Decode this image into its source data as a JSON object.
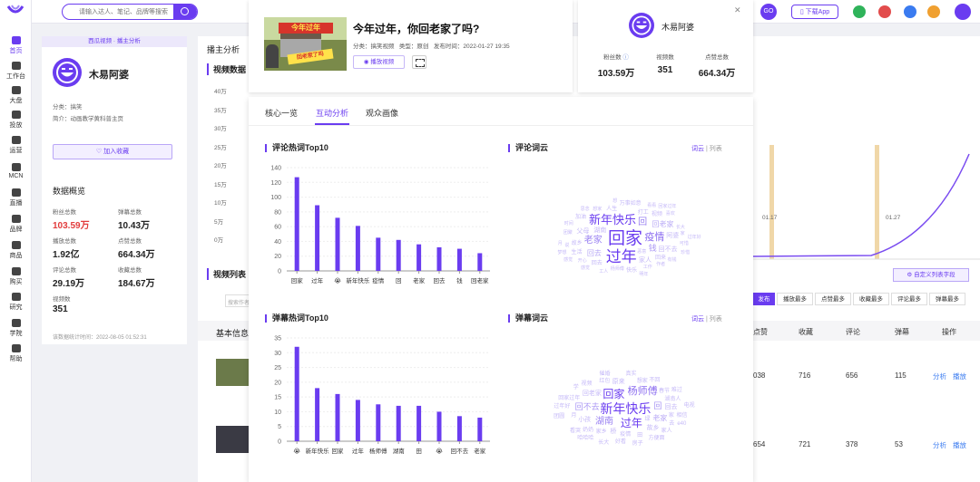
{
  "sidebar": {
    "items": [
      {
        "label": "首页",
        "active": true
      },
      {
        "label": "工作台"
      },
      {
        "label": "大盘"
      },
      {
        "label": "投放"
      },
      {
        "label": "运营"
      },
      {
        "label": "MCN"
      },
      {
        "label": "直播"
      },
      {
        "label": "品牌"
      },
      {
        "label": "商品"
      },
      {
        "label": "购买"
      },
      {
        "label": "研究"
      },
      {
        "label": "学院"
      },
      {
        "label": "帮助"
      }
    ]
  },
  "topbar": {
    "search_placeholder": "请输入达人、笔记、品牌等搜索",
    "go_label": "GO",
    "download_label": "下载App"
  },
  "left_panel": {
    "banner": "西瓜视频 · 播主分析",
    "name": "木易阿婆",
    "category_label": "分类：",
    "category": "搞笑",
    "intro_label": "简介：",
    "intro": "动画教学黄科普主页",
    "follow_label": "加入收藏",
    "section_title": "数据概览",
    "stats": [
      {
        "label": "粉丝总数",
        "value": "103.59万"
      },
      {
        "label": "弹幕总数",
        "value": "10.43万"
      },
      {
        "label": "播放总数",
        "value": "1.92亿"
      },
      {
        "label": "点赞总数",
        "value": "664.34万"
      },
      {
        "label": "评论总数",
        "value": "29.19万"
      },
      {
        "label": "收藏总数",
        "value": "184.67万"
      },
      {
        "label": "视频数",
        "value": "351"
      }
    ],
    "footer": "该数据统计时间：2022-08-05 01:52:31"
  },
  "background": {
    "header_title": "播主分析",
    "video_data_title": "视频数据",
    "video_list_title": "视频列表",
    "base_info_label": "基本信息",
    "search_placeholder": "搜索作者视频",
    "y_ticks": [
      "40万",
      "35万",
      "30万",
      "25万",
      "20万",
      "15万",
      "10万",
      "5万",
      "0万"
    ],
    "x_labels": [
      "01.17",
      "01.27"
    ],
    "custom_cols_label": "自定义列表字段",
    "sort_tabs": [
      "发布",
      "播放最多",
      "点赞最多",
      "收藏最多",
      "评论最多",
      "弹幕最多"
    ],
    "columns": [
      "点赞",
      "收藏",
      "评论",
      "弹幕",
      "操作"
    ],
    "rows": [
      {
        "likes": "038",
        "favorites": "716",
        "comments": "656",
        "danmaku": "115"
      },
      {
        "likes": "654",
        "favorites": "721",
        "comments": "378",
        "danmaku": "53"
      }
    ],
    "analyze_label": "分析",
    "play_label": "播放"
  },
  "video_card": {
    "thumb_text": "今年过年",
    "thumb_sub": "回老家了吗",
    "title": "今年过年，你回老家了吗?",
    "category": "分类：搞笑视频",
    "type": "类型：原创",
    "publish_time": "发布时间：2022-01-27 19:35",
    "play_label": "播放视频"
  },
  "author_card": {
    "name": "木易阿婆",
    "stats": [
      {
        "label": "粉丝数",
        "value": "103.59万"
      },
      {
        "label": "视频数",
        "value": "351"
      },
      {
        "label": "点赞总数",
        "value": "664.34万"
      }
    ]
  },
  "modal": {
    "tabs": [
      "核心一览",
      "互动分析",
      "观众画像"
    ],
    "active_tab": 1,
    "comment_top_title": "评论热词Top10",
    "comment_cloud_title": "评论词云",
    "danmaku_top_title": "弹幕热词Top10",
    "danmaku_cloud_title": "弹幕词云",
    "cloud_switch": {
      "cloud": "词云",
      "list": "列表"
    }
  },
  "chart_data": [
    {
      "type": "bar",
      "title": "评论热词Top10",
      "categories": [
        "回家",
        "过年",
        "😭",
        "新年快乐",
        "疫情",
        "回",
        "老家",
        "回去",
        "钱",
        "回老家"
      ],
      "values": [
        127,
        89,
        72,
        61,
        45,
        42,
        36,
        32,
        30,
        24
      ],
      "ylim": [
        0,
        140
      ],
      "y_ticks": [
        0,
        20,
        40,
        60,
        80,
        100,
        120,
        140
      ],
      "grid": true,
      "color": "#6a3cf0"
    },
    {
      "type": "bar",
      "title": "弹幕热词Top10",
      "categories": [
        "😭",
        "新年快乐",
        "回家",
        "过年",
        "杨师傅",
        "湖南",
        "田",
        "😭",
        "回不去",
        "老家"
      ],
      "values": [
        32,
        18,
        16,
        14,
        12.5,
        12,
        12,
        10,
        8.5,
        8
      ],
      "ylim": [
        0,
        35
      ],
      "y_ticks": [
        0,
        5,
        10,
        15,
        20,
        25,
        30,
        35
      ],
      "grid": true,
      "color": "#6a3cf0"
    }
  ],
  "comment_cloud": [
    {
      "t": "回家",
      "s": 19
    },
    {
      "t": "过年",
      "s": 17
    },
    {
      "t": "新年快乐",
      "s": 13
    },
    {
      "t": "疫情",
      "s": 11
    },
    {
      "t": "老家",
      "s": 10
    },
    {
      "t": "回",
      "s": 10
    },
    {
      "t": "钱",
      "s": 9
    },
    {
      "t": "回老家",
      "s": 8
    },
    {
      "t": "回去",
      "s": 8
    },
    {
      "t": "湖南",
      "s": 7
    },
    {
      "t": "家人",
      "s": 7
    },
    {
      "t": "阿婆",
      "s": 7
    },
    {
      "t": "回不去",
      "s": 7
    },
    {
      "t": "父母",
      "s": 7
    },
    {
      "t": "故乡",
      "s": 6
    },
    {
      "t": "回去",
      "s": 6
    },
    {
      "t": "打工",
      "s": 6
    },
    {
      "t": "回来",
      "s": 6
    },
    {
      "t": "人生",
      "s": 6
    },
    {
      "t": "视频",
      "s": 6
    },
    {
      "t": "加油",
      "s": 6
    },
    {
      "t": "生活",
      "s": 6
    },
    {
      "t": "快乐",
      "s": 6
    },
    {
      "t": "万事如意",
      "s": 6
    },
    {
      "t": "工作",
      "s": 5
    },
    {
      "t": "杨师傅",
      "s": 5
    },
    {
      "t": "团聚",
      "s": 5
    },
    {
      "t": "长大",
      "s": 5
    },
    {
      "t": "作者",
      "s": 5
    },
    {
      "t": "时间",
      "s": 5
    },
    {
      "t": "开心",
      "s": 5
    },
    {
      "t": "说",
      "s": 5
    },
    {
      "t": "恶意",
      "s": 5
    },
    {
      "t": "可惜",
      "s": 5
    },
    {
      "t": "想家",
      "s": 5
    },
    {
      "t": "家",
      "s": 5
    },
    {
      "t": "感觉",
      "s": 5
    },
    {
      "t": "喜欢",
      "s": 5
    },
    {
      "t": "工人",
      "s": 5
    },
    {
      "t": "有钱",
      "s": 5
    },
    {
      "t": "思念",
      "s": 5
    },
    {
      "t": "珍惜",
      "s": 5
    },
    {
      "t": "看看",
      "s": 5
    },
    {
      "t": "回家过年",
      "s": 5
    },
    {
      "t": "过年好",
      "s": 5
    },
    {
      "t": "月",
      "s": 5
    },
    {
      "t": "想",
      "s": 5
    },
    {
      "t": "明年",
      "s": 5
    },
    {
      "t": "感觉",
      "s": 5
    },
    {
      "t": "梦想",
      "s": 5
    }
  ],
  "danmaku_cloud": [
    {
      "t": "新年快乐",
      "s": 14
    },
    {
      "t": "过年",
      "s": 12
    },
    {
      "t": "回家",
      "s": 12
    },
    {
      "t": "杨师傅",
      "s": 11
    },
    {
      "t": "湖南",
      "s": 10
    },
    {
      "t": "回不去",
      "s": 9
    },
    {
      "t": "回",
      "s": 9
    },
    {
      "t": "老家",
      "s": 8
    },
    {
      "t": "回老家",
      "s": 7
    },
    {
      "t": "故乡",
      "s": 7
    },
    {
      "t": "原来",
      "s": 7
    },
    {
      "t": "小孩",
      "s": 7
    },
    {
      "t": "桥",
      "s": 7
    },
    {
      "t": "回去",
      "s": 7
    },
    {
      "t": "疫情",
      "s": 6
    },
    {
      "t": "湖南人",
      "s": 6
    },
    {
      "t": "田",
      "s": 6
    },
    {
      "t": "绿",
      "s": 6
    },
    {
      "t": "家",
      "s": 6
    },
    {
      "t": "红包",
      "s": 6
    },
    {
      "t": "家乡",
      "s": 6
    },
    {
      "t": "想家",
      "s": 6
    },
    {
      "t": "春节",
      "s": 6
    },
    {
      "t": "奶奶",
      "s": 6
    },
    {
      "t": "月",
      "s": 6
    },
    {
      "t": "回家过年",
      "s": 6
    },
    {
      "t": "视频",
      "s": 6
    },
    {
      "t": "不回",
      "s": 6
    },
    {
      "t": "相信",
      "s": 6
    },
    {
      "t": "家人",
      "s": 6
    },
    {
      "t": "真实",
      "s": 6
    },
    {
      "t": "难过",
      "s": 6
    },
    {
      "t": "方便面",
      "s": 6
    },
    {
      "t": "去",
      "s": 6
    },
    {
      "t": "过年好",
      "s": 6
    },
    {
      "t": "好看",
      "s": 6
    },
    {
      "t": "哈哈哈",
      "s": 6
    },
    {
      "t": "学",
      "s": 6
    },
    {
      "t": "长大",
      "s": 6
    },
    {
      "t": "看哭",
      "s": 6
    },
    {
      "t": "催婚",
      "s": 6
    },
    {
      "t": "e40",
      "s": 6
    },
    {
      "t": "电视",
      "s": 6
    },
    {
      "t": "团圆",
      "s": 6
    },
    {
      "t": "房子",
      "s": 6
    }
  ]
}
